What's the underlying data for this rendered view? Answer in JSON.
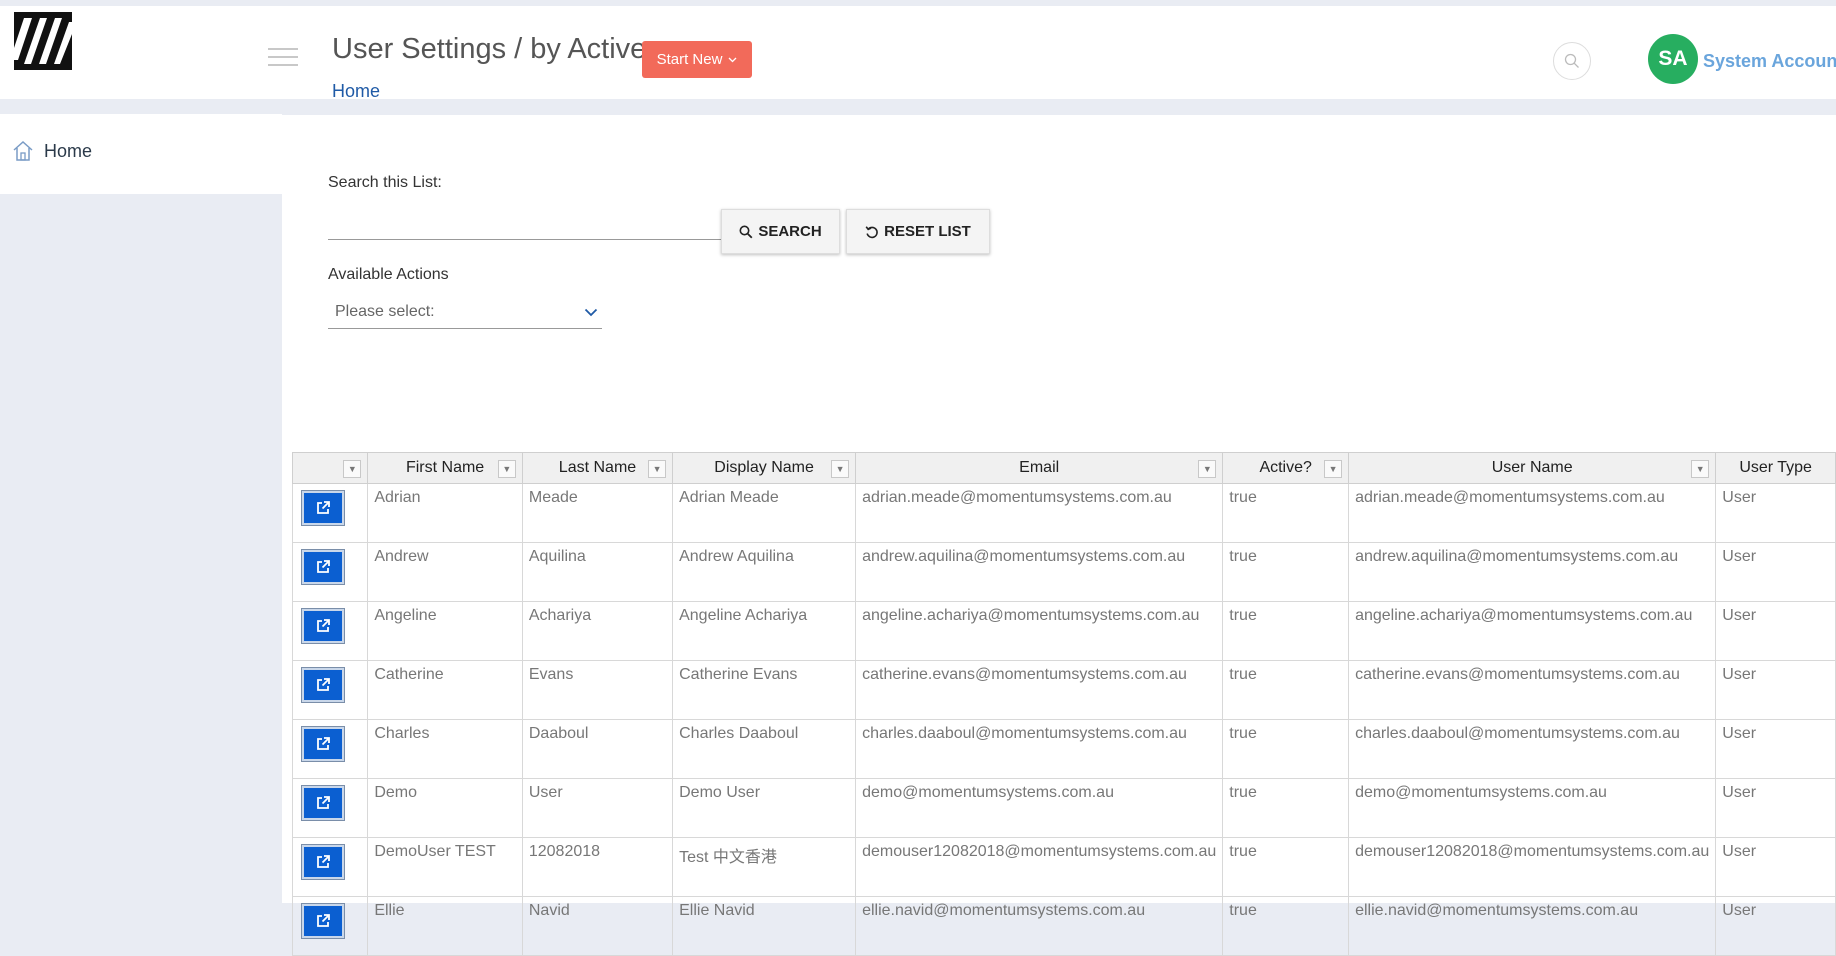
{
  "header": {
    "title": "User Settings / by Active",
    "start_new_label": "Start New",
    "breadcrumb": "Home",
    "avatar_initials": "SA",
    "account_name": "System Account"
  },
  "sidebar": {
    "items": [
      {
        "label": "Home",
        "icon": "home-icon"
      }
    ]
  },
  "search": {
    "label": "Search this List:",
    "value": "",
    "search_button": "SEARCH",
    "reset_button": "RESET LIST"
  },
  "actions": {
    "label": "Available Actions",
    "selected": "Please select:"
  },
  "table": {
    "columns": [
      "First Name",
      "Last Name",
      "Display Name",
      "Email",
      "Active?",
      "User Name",
      "User Type"
    ],
    "rows": [
      [
        "Adrian",
        "Meade",
        "Adrian Meade",
        "adrian.meade@momentumsystems.com.au",
        "true",
        "adrian.meade@momentumsystems.com.au",
        "User"
      ],
      [
        "Andrew",
        "Aquilina",
        "Andrew Aquilina",
        "andrew.aquilina@momentumsystems.com.au",
        "true",
        "andrew.aquilina@momentumsystems.com.au",
        "User"
      ],
      [
        "Angeline",
        "Achariya",
        "Angeline Achariya",
        "angeline.achariya@momentumsystems.com.au",
        "true",
        "angeline.achariya@momentumsystems.com.au",
        "User"
      ],
      [
        "Catherine",
        "Evans",
        "Catherine Evans",
        "catherine.evans@momentumsystems.com.au",
        "true",
        "catherine.evans@momentumsystems.com.au",
        "User"
      ],
      [
        "Charles",
        "Daaboul",
        "Charles Daaboul",
        "charles.daaboul@momentumsystems.com.au",
        "true",
        "charles.daaboul@momentumsystems.com.au",
        "User"
      ],
      [
        "Demo",
        "User",
        "Demo User",
        "demo@momentumsystems.com.au",
        "true",
        "demo@momentumsystems.com.au",
        "User"
      ],
      [
        "DemoUser TEST",
        "12082018",
        "Test 中文香港",
        "demouser12082018@momentumsystems.com.au",
        "true",
        "demouser12082018@momentumsystems.com.au",
        "User"
      ],
      [
        "Ellie",
        "Navid",
        "Ellie Navid",
        "ellie.navid@momentumsystems.com.au",
        "true",
        "ellie.navid@momentumsystems.com.au",
        "User"
      ]
    ]
  },
  "colors": {
    "accent_button": "#f26a5a",
    "link": "#1f5aa6",
    "avatar": "#27ae60",
    "account_name": "#6aa5dc",
    "row_action_button": "#0b5fd1"
  }
}
